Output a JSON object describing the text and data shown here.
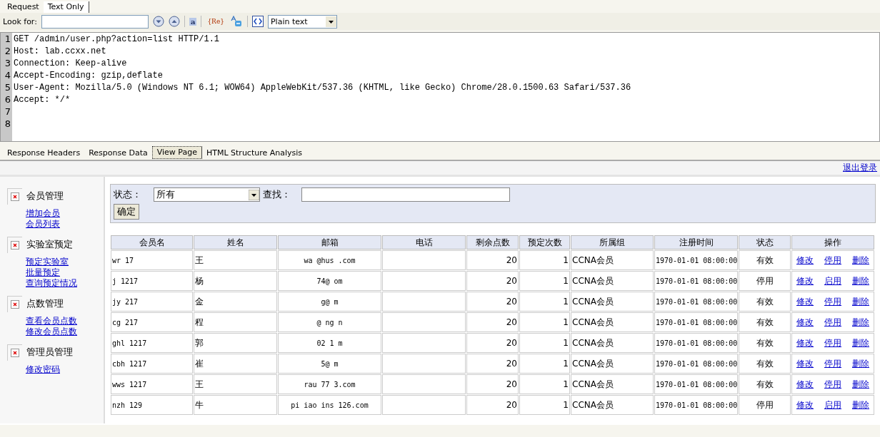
{
  "request_tabs": [
    {
      "label": "Request",
      "selected": false
    },
    {
      "label": "Text Only",
      "selected": true
    }
  ],
  "toolbar": {
    "look_for_label": "Look for:",
    "match_case_label": "a",
    "regex_label": "{Re}",
    "mode_select": "Plain text"
  },
  "request_lines": [
    {
      "number": "1",
      "text": "GET /admin/user.php?action=list HTTP/1.1"
    },
    {
      "number": "2",
      "text": "Host: lab.ccxx.net"
    },
    {
      "number": "3",
      "text": "Connection: Keep-alive"
    },
    {
      "number": "4",
      "text": "Accept-Encoding: gzip,deflate"
    },
    {
      "number": "5",
      "text": "User-Agent: Mozilla/5.0 (Windows NT 6.1; WOW64) AppleWebKit/537.36 (KHTML, like Gecko) Chrome/28.0.1500.63 Safari/537.36"
    },
    {
      "number": "6",
      "text": "Accept: */*"
    },
    {
      "number": "7"
    },
    {
      "number": "8"
    }
  ],
  "response_tabs": [
    {
      "label": "Response Headers",
      "selected": false
    },
    {
      "label": "Response Data",
      "selected": false
    },
    {
      "label": "View Page",
      "selected": true
    },
    {
      "label": "HTML Structure Analysis",
      "selected": false
    }
  ],
  "page": {
    "logout_link": "退出登录",
    "sidebar": [
      {
        "title": "会员管理",
        "links": [
          "增加会员",
          "会员列表"
        ]
      },
      {
        "title": "实验室预定",
        "links": [
          "预定实验室",
          "批量预定",
          "查询预定情况"
        ]
      },
      {
        "title": "点数管理",
        "links": [
          "查看会员点数",
          "修改会员点数"
        ]
      },
      {
        "title": "管理员管理",
        "links": [
          "修改密码"
        ]
      }
    ],
    "filter": {
      "status_label": "状态：",
      "status_value": "所有",
      "search_label": "查找：",
      "submit_button": "确定"
    },
    "table": {
      "columns": [
        "会员名",
        "姓名",
        "邮箱",
        "电话",
        "剩余点数",
        "预定次数",
        "所属组",
        "注册时间",
        "状态",
        "操作"
      ],
      "rows": [
        {
          "username": "wr 17",
          "name": "王",
          "email": "wa @hus .com",
          "points": "20",
          "bookings": "1",
          "group": "CCNA会员",
          "registered": "1970-01-01 08:00:00",
          "status": "有效",
          "actions": [
            "修改",
            "停用",
            "删除"
          ]
        },
        {
          "username": "j 1217",
          "name": "杨",
          "email": "74@ om",
          "points": "20",
          "bookings": "1",
          "group": "CCNA会员",
          "registered": "1970-01-01 08:00:00",
          "status": "停用",
          "actions": [
            "修改",
            "启用",
            "删除"
          ]
        },
        {
          "username": "jy 217",
          "name": "金",
          "email": "g@ m",
          "points": "20",
          "bookings": "1",
          "group": "CCNA会员",
          "registered": "1970-01-01 08:00:00",
          "status": "有效",
          "actions": [
            "修改",
            "停用",
            "删除"
          ]
        },
        {
          "username": "cg 217",
          "name": "程",
          "email": "@ ng n",
          "points": "20",
          "bookings": "1",
          "group": "CCNA会员",
          "registered": "1970-01-01 08:00:00",
          "status": "有效",
          "actions": [
            "修改",
            "停用",
            "删除"
          ]
        },
        {
          "username": "ghl 1217",
          "name": "郭",
          "email": "02 1 m",
          "points": "20",
          "bookings": "1",
          "group": "CCNA会员",
          "registered": "1970-01-01 08:00:00",
          "status": "有效",
          "actions": [
            "修改",
            "停用",
            "删除"
          ]
        },
        {
          "username": "cbh 1217",
          "name": "崔",
          "email": "5@ m",
          "points": "20",
          "bookings": "1",
          "group": "CCNA会员",
          "registered": "1970-01-01 08:00:00",
          "status": "有效",
          "actions": [
            "修改",
            "停用",
            "删除"
          ]
        },
        {
          "username": "wws 1217",
          "name": "王",
          "email": "rau 77 3.com",
          "points": "20",
          "bookings": "1",
          "group": "CCNA会员",
          "registered": "1970-01-01 08:00:00",
          "status": "有效",
          "actions": [
            "修改",
            "停用",
            "删除"
          ]
        },
        {
          "username": "nzh 129",
          "name": "牛",
          "email": "pi iao ins 126.com",
          "points": "20",
          "bookings": "1",
          "group": "CCNA会员",
          "registered": "1970-01-01 08:00:00",
          "status": "停用",
          "actions": [
            "修改",
            "启用",
            "删除"
          ]
        }
      ]
    }
  }
}
